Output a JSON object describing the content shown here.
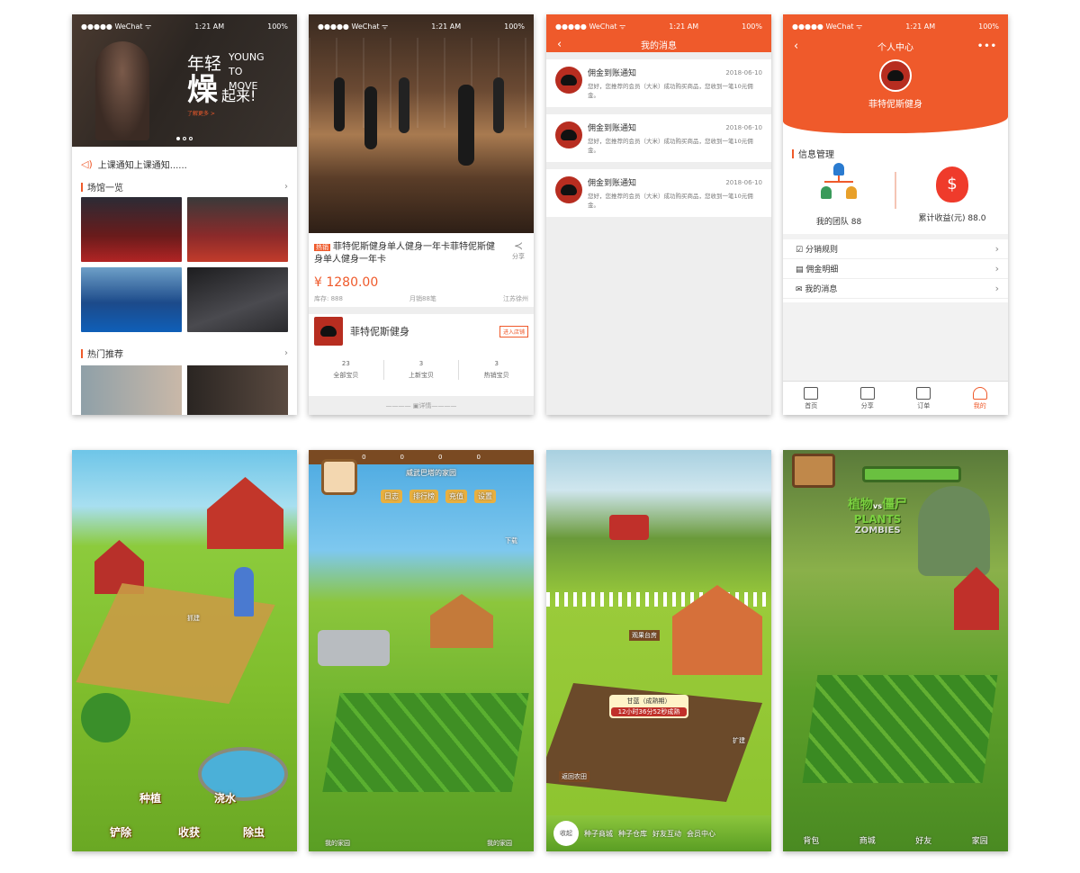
{
  "status": {
    "carrier": "●●●●● WeChat ᯤ",
    "time": "1:21 AM",
    "battery": "100%"
  },
  "s1": {
    "banner_big1": "年轻",
    "banner_big2": "燥",
    "banner_big3": "起来!",
    "banner_en1": "YOUNG",
    "banner_en2": "TO",
    "banner_en3": "MOVE",
    "banner_link": "了解更多 >",
    "notice": "上课通知上课通知......",
    "section_venues": "场馆一览",
    "section_hot": "热门推荐"
  },
  "s2": {
    "hot_tag": "热销",
    "title": "菲特伲斯健身单人健身一年卡菲特伲斯健身单人健身一年卡",
    "share": "分享",
    "price": "¥ 1280.00",
    "stock": "库存: 888",
    "monthly": "月销88笔",
    "location": "江苏徐州",
    "shop_name": "菲特伲斯健身",
    "enter_shop": "进入店铺",
    "stats": [
      {
        "num": "23",
        "label": "全部宝贝"
      },
      {
        "num": "3",
        "label": "上新宝贝"
      },
      {
        "num": "3",
        "label": "热销宝贝"
      }
    ],
    "detail": "详情"
  },
  "s3": {
    "nav_title": "我的消息",
    "messages": [
      {
        "title": "佣金到账通知",
        "date": "2018-06-10",
        "body": "您好，您推荐的会员（大米）成功购买商品，您收到一笔10元佣金。"
      },
      {
        "title": "佣金到账通知",
        "date": "2018-06-10",
        "body": "您好，您推荐的会员（大米）成功购买商品，您收到一笔10元佣金。"
      },
      {
        "title": "佣金到账通知",
        "date": "2018-06-10",
        "body": "您好，您推荐的会员（大米）成功购买商品，您收到一笔10元佣金。"
      }
    ]
  },
  "s4": {
    "nav_title": "个人中心",
    "more": "•••",
    "username": "菲特伲斯健身",
    "info_title": "信息管理",
    "team_label": "我的团队",
    "team_value": "88",
    "earn_label": "累计收益(元)",
    "earn_value": "88.0",
    "menu": [
      "分销规则",
      "佣金明细",
      "我的消息"
    ],
    "tabs": [
      "首页",
      "分享",
      "订单",
      "我的"
    ]
  },
  "g1": {
    "sign": "抓建",
    "b1": "种植",
    "b2": "浇水",
    "b3": "铲除",
    "b4": "收获",
    "b5": "除虫"
  },
  "g2": {
    "coins": [
      "0",
      "0",
      "0",
      "0"
    ],
    "title": "威武巴塔的家园",
    "menu": [
      "日志",
      "排行榜",
      "充值",
      "设置"
    ],
    "corner": "下载",
    "btn_left": "我的家园",
    "btn_right": "我的家园"
  },
  "g3": {
    "sign": "观果台房",
    "crop": "甘蓝（成熟期）",
    "timer": "12小时36分52秒成熟",
    "tag": "扩建",
    "back": "返回农田",
    "collect": "收起",
    "menu": [
      "种子商城",
      "种子仓库",
      "好友互动",
      "会员中心"
    ]
  },
  "g4": {
    "logo_cn1": "植物",
    "logo_cn2": "僵尸",
    "logo_en1": "PLANTS",
    "logo_en2": "vs",
    "logo_en3": "ZOMBIES",
    "menu": [
      "背包",
      "商城",
      "好友",
      "家园"
    ]
  }
}
